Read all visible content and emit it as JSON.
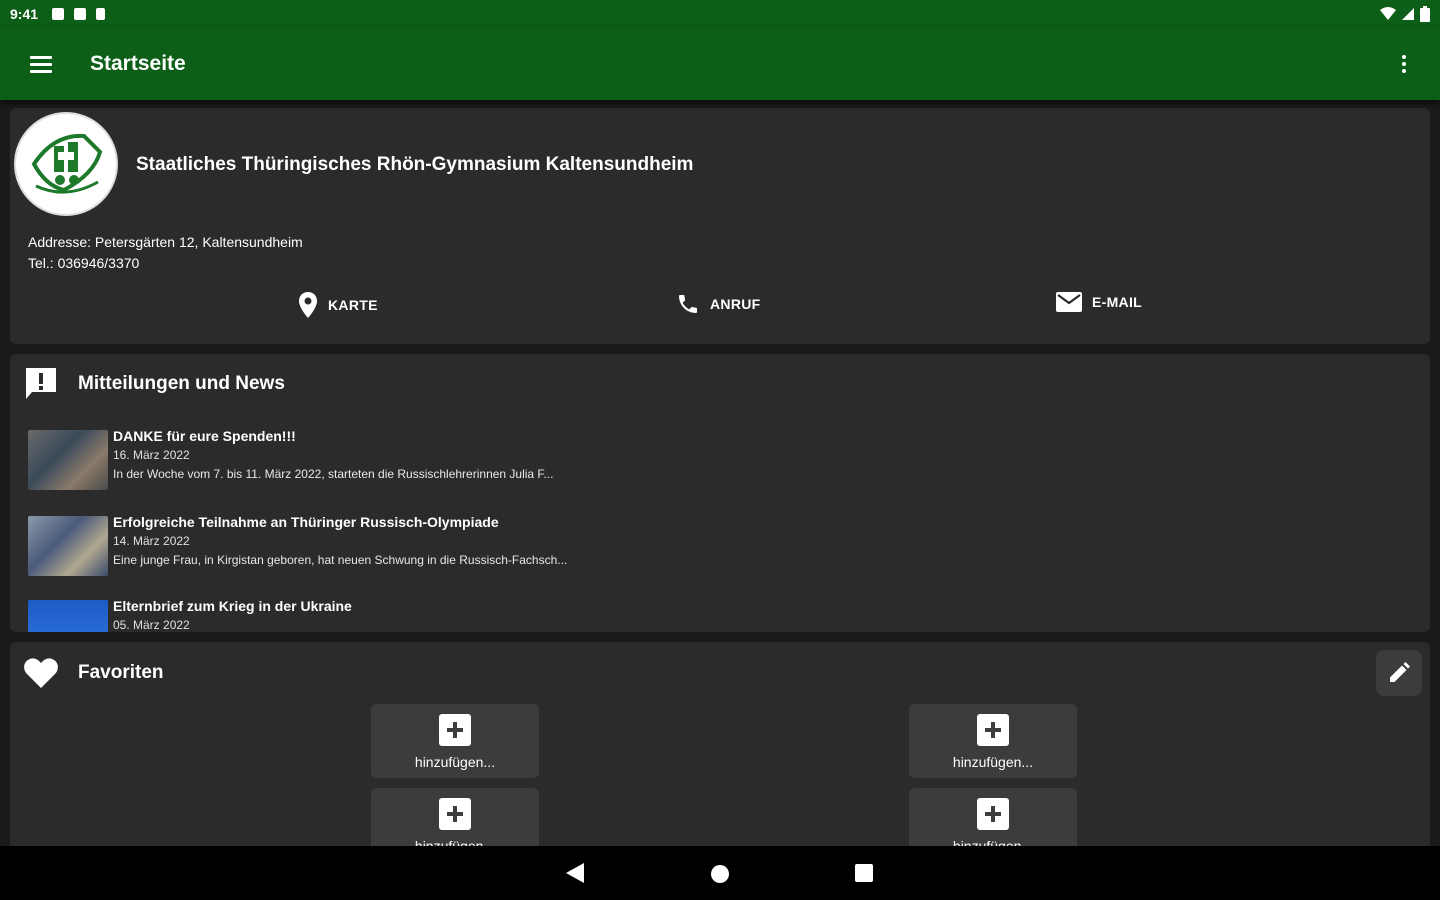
{
  "status": {
    "time": "9:41"
  },
  "appbar": {
    "title": "Startseite"
  },
  "school": {
    "name": "Staatliches Thüringisches Rhön-Gymnasium Kaltensundheim",
    "address": "Addresse: Petersgärten 12, Kaltensundheim",
    "phone": "Tel.: 036946/3370",
    "actions": {
      "map": "KARTE",
      "call": "ANRUF",
      "email": "E-MAIL"
    }
  },
  "news": {
    "heading": "Mitteilungen und News",
    "items": [
      {
        "title": "DANKE für eure Spenden!!!",
        "date": "16. März 2022",
        "excerpt": "In der Woche vom 7. bis 11. März 2022, starteten die Russischlehrerinnen Julia F..."
      },
      {
        "title": "Erfolgreiche Teilnahme an Thüringer Russisch-Olympiade",
        "date": "14. März 2022",
        "excerpt": "Eine junge Frau, in Kirgistan geboren, hat neuen Schwung in die Russisch-Fachsch..."
      },
      {
        "title": "Elternbrief zum Krieg in der Ukraine",
        "date": "05. März 2022",
        "excerpt": ""
      }
    ]
  },
  "favorites": {
    "heading": "Favoriten",
    "tiles": [
      "hinzufügen...",
      "hinzufügen...",
      "hinzufügen...",
      "hinzufügen..."
    ]
  },
  "colors": {
    "primary": "#0d5e17",
    "card": "#2b2b2b",
    "tile": "#3c3c3c",
    "background": "#1a1a1a"
  }
}
